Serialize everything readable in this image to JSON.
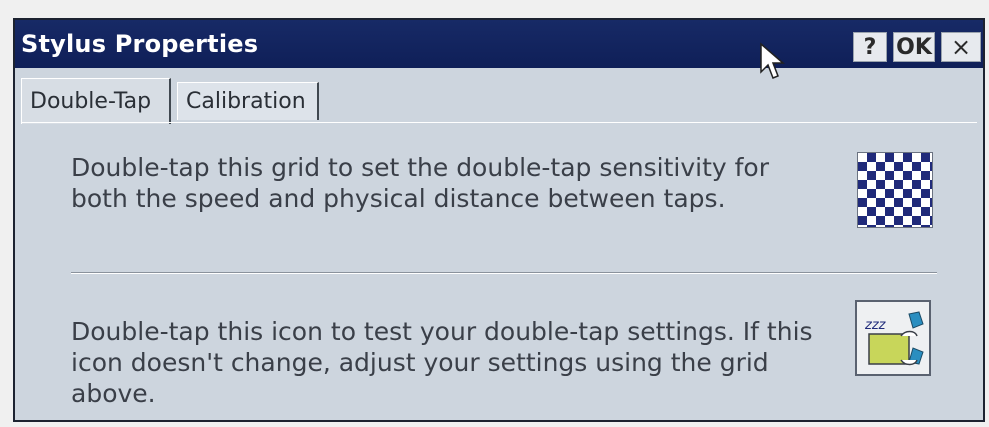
{
  "window": {
    "title": "Stylus Properties",
    "buttons": {
      "help": "?",
      "ok": "OK",
      "close": "×"
    }
  },
  "tabs": [
    {
      "label": "Double-Tap",
      "active": true
    },
    {
      "label": "Calibration",
      "active": false
    }
  ],
  "double_tap": {
    "grid_instruction": "Double-tap this grid to set the double-tap sensitivity for both the speed and physical distance between taps.",
    "test_instruction": "Double-tap this icon to test your double-tap settings. If this icon doesn't change, adjust your settings using the grid above."
  },
  "icons": {
    "grid": "checkerboard-grid-icon",
    "test": "sleeping-box-test-icon",
    "cursor": "mouse-pointer-icon"
  },
  "colors": {
    "titlebar": "#0f1f58",
    "window_bg": "#cdd5de",
    "grid_blue": "#202a7a"
  }
}
